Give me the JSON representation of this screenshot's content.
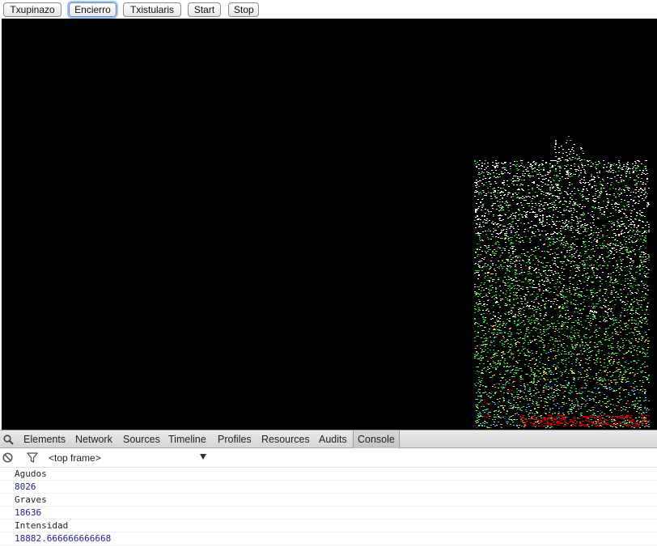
{
  "buttons": {
    "txupinazo": "Txupinazo",
    "encierro": "Encierro",
    "txistularis": "Txistularis",
    "start": "Start",
    "stop": "Stop"
  },
  "devtools": {
    "tabs": [
      "Elements",
      "Network",
      "Sources",
      "Timeline",
      "Profiles",
      "Resources",
      "Audits",
      "Console"
    ],
    "active_tab": "Console",
    "frame": "<top frame>",
    "console": [
      {
        "text": "Agudos",
        "kind": "log"
      },
      {
        "text": "8026",
        "kind": "number"
      },
      {
        "text": "Graves",
        "kind": "log"
      },
      {
        "text": "18636",
        "kind": "number"
      },
      {
        "text": "Intensidad",
        "kind": "log"
      },
      {
        "text": "18882.666666666668",
        "kind": "number"
      }
    ]
  },
  "spectrogram": {
    "background": "#000000",
    "colors": {
      "high": "#ffffff",
      "mid": "#22dd22",
      "low": "#eeee00",
      "floor": "#22e0e0",
      "peak": "#dd0000"
    }
  }
}
